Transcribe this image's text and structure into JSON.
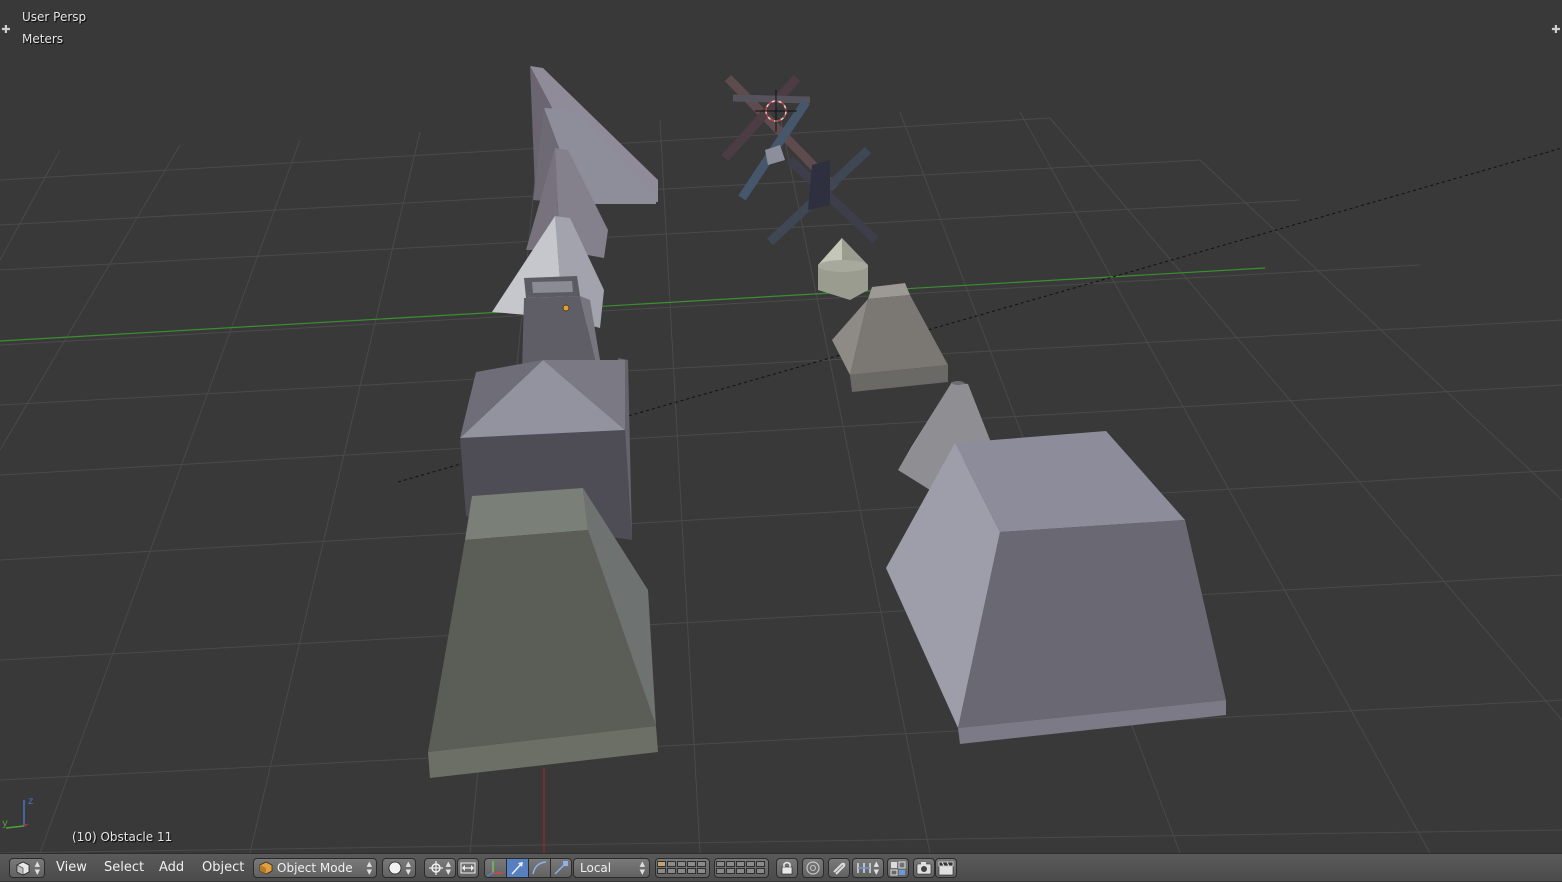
{
  "viewport": {
    "view_name": "User Persp",
    "units": "Meters",
    "object_info": "(10) Obstacle 11",
    "axis_widget": {
      "x_label": "y",
      "z_label": "z"
    }
  },
  "header": {
    "editor_type_icon": "3d-view-cube-icon",
    "menus": [
      "View",
      "Select",
      "Add",
      "Object"
    ],
    "mode": "Object Mode",
    "shading_icon": "solid-sphere-icon",
    "pivot_icon": "pivot-point-icon",
    "transform_orientation": "Local",
    "colors": {
      "background": "#393939",
      "header": "#555555",
      "grid": "#4b4b4b",
      "x_axis": "#3a8f2f",
      "z_axis": "#8a2c2c",
      "manip_active": "#5680c2"
    }
  }
}
